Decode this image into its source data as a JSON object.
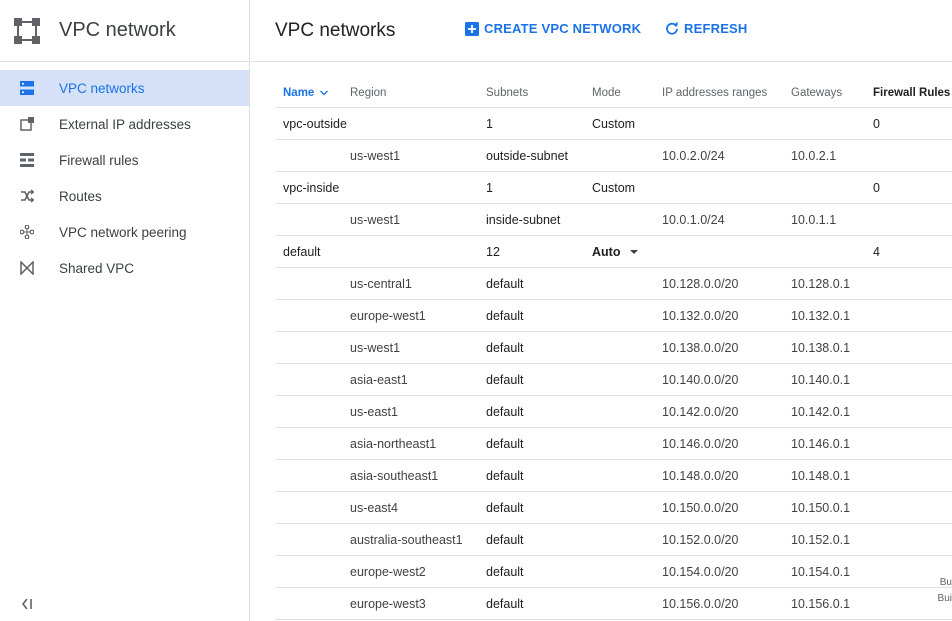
{
  "app": {
    "title": "VPC network"
  },
  "sidebar": {
    "items": [
      {
        "label": "VPC networks",
        "icon": "vpc-networks-icon",
        "active": true
      },
      {
        "label": "External IP addresses",
        "icon": "external-ip-icon",
        "active": false
      },
      {
        "label": "Firewall rules",
        "icon": "firewall-icon",
        "active": false
      },
      {
        "label": "Routes",
        "icon": "routes-icon",
        "active": false
      },
      {
        "label": "VPC network peering",
        "icon": "peering-icon",
        "active": false
      },
      {
        "label": "Shared VPC",
        "icon": "shared-vpc-icon",
        "active": false
      }
    ],
    "collapse_icon": "collapse-sidebar-icon"
  },
  "header": {
    "title": "VPC networks",
    "create_label": "CREATE VPC NETWORK",
    "refresh_label": "REFRESH"
  },
  "table": {
    "columns": {
      "name": "Name",
      "region": "Region",
      "subnets": "Subnets",
      "mode": "Mode",
      "ip": "IP addresses ranges",
      "gateways": "Gateways",
      "firewall": "Firewall Rules"
    },
    "rows": [
      {
        "type": "network",
        "name": "vpc-outside",
        "subnets": "1",
        "mode": "Custom",
        "firewall": "0"
      },
      {
        "type": "subnet",
        "region": "us-west1",
        "subnet": "outside-subnet",
        "ip": "10.0.2.0/24",
        "gateway": "10.0.2.1"
      },
      {
        "type": "network",
        "name": "vpc-inside",
        "subnets": "1",
        "mode": "Custom",
        "firewall": "0"
      },
      {
        "type": "subnet",
        "region": "us-west1",
        "subnet": "inside-subnet",
        "ip": "10.0.1.0/24",
        "gateway": "10.0.1.1"
      },
      {
        "type": "network",
        "name": "default",
        "subnets": "12",
        "mode": "Auto",
        "mode_dropdown": true,
        "firewall": "4"
      },
      {
        "type": "subnet",
        "region": "us-central1",
        "subnet": "default",
        "ip": "10.128.0.0/20",
        "gateway": "10.128.0.1"
      },
      {
        "type": "subnet",
        "region": "europe-west1",
        "subnet": "default",
        "ip": "10.132.0.0/20",
        "gateway": "10.132.0.1"
      },
      {
        "type": "subnet",
        "region": "us-west1",
        "subnet": "default",
        "ip": "10.138.0.0/20",
        "gateway": "10.138.0.1"
      },
      {
        "type": "subnet",
        "region": "asia-east1",
        "subnet": "default",
        "ip": "10.140.0.0/20",
        "gateway": "10.140.0.1"
      },
      {
        "type": "subnet",
        "region": "us-east1",
        "subnet": "default",
        "ip": "10.142.0.0/20",
        "gateway": "10.142.0.1"
      },
      {
        "type": "subnet",
        "region": "asia-northeast1",
        "subnet": "default",
        "ip": "10.146.0.0/20",
        "gateway": "10.146.0.1"
      },
      {
        "type": "subnet",
        "region": "asia-southeast1",
        "subnet": "default",
        "ip": "10.148.0.0/20",
        "gateway": "10.148.0.1"
      },
      {
        "type": "subnet",
        "region": "us-east4",
        "subnet": "default",
        "ip": "10.150.0.0/20",
        "gateway": "10.150.0.1"
      },
      {
        "type": "subnet",
        "region": "australia-southeast1",
        "subnet": "default",
        "ip": "10.152.0.0/20",
        "gateway": "10.152.0.1"
      },
      {
        "type": "subnet",
        "region": "europe-west2",
        "subnet": "default",
        "ip": "10.154.0.0/20",
        "gateway": "10.154.0.1"
      },
      {
        "type": "subnet",
        "region": "europe-west3",
        "subnet": "default",
        "ip": "10.156.0.0/20",
        "gateway": "10.156.0.1"
      }
    ]
  },
  "edge_texts": [
    "Bu",
    "Bui"
  ],
  "colors": {
    "accent": "#1a73e8",
    "active_bg": "#d4e1f8"
  }
}
